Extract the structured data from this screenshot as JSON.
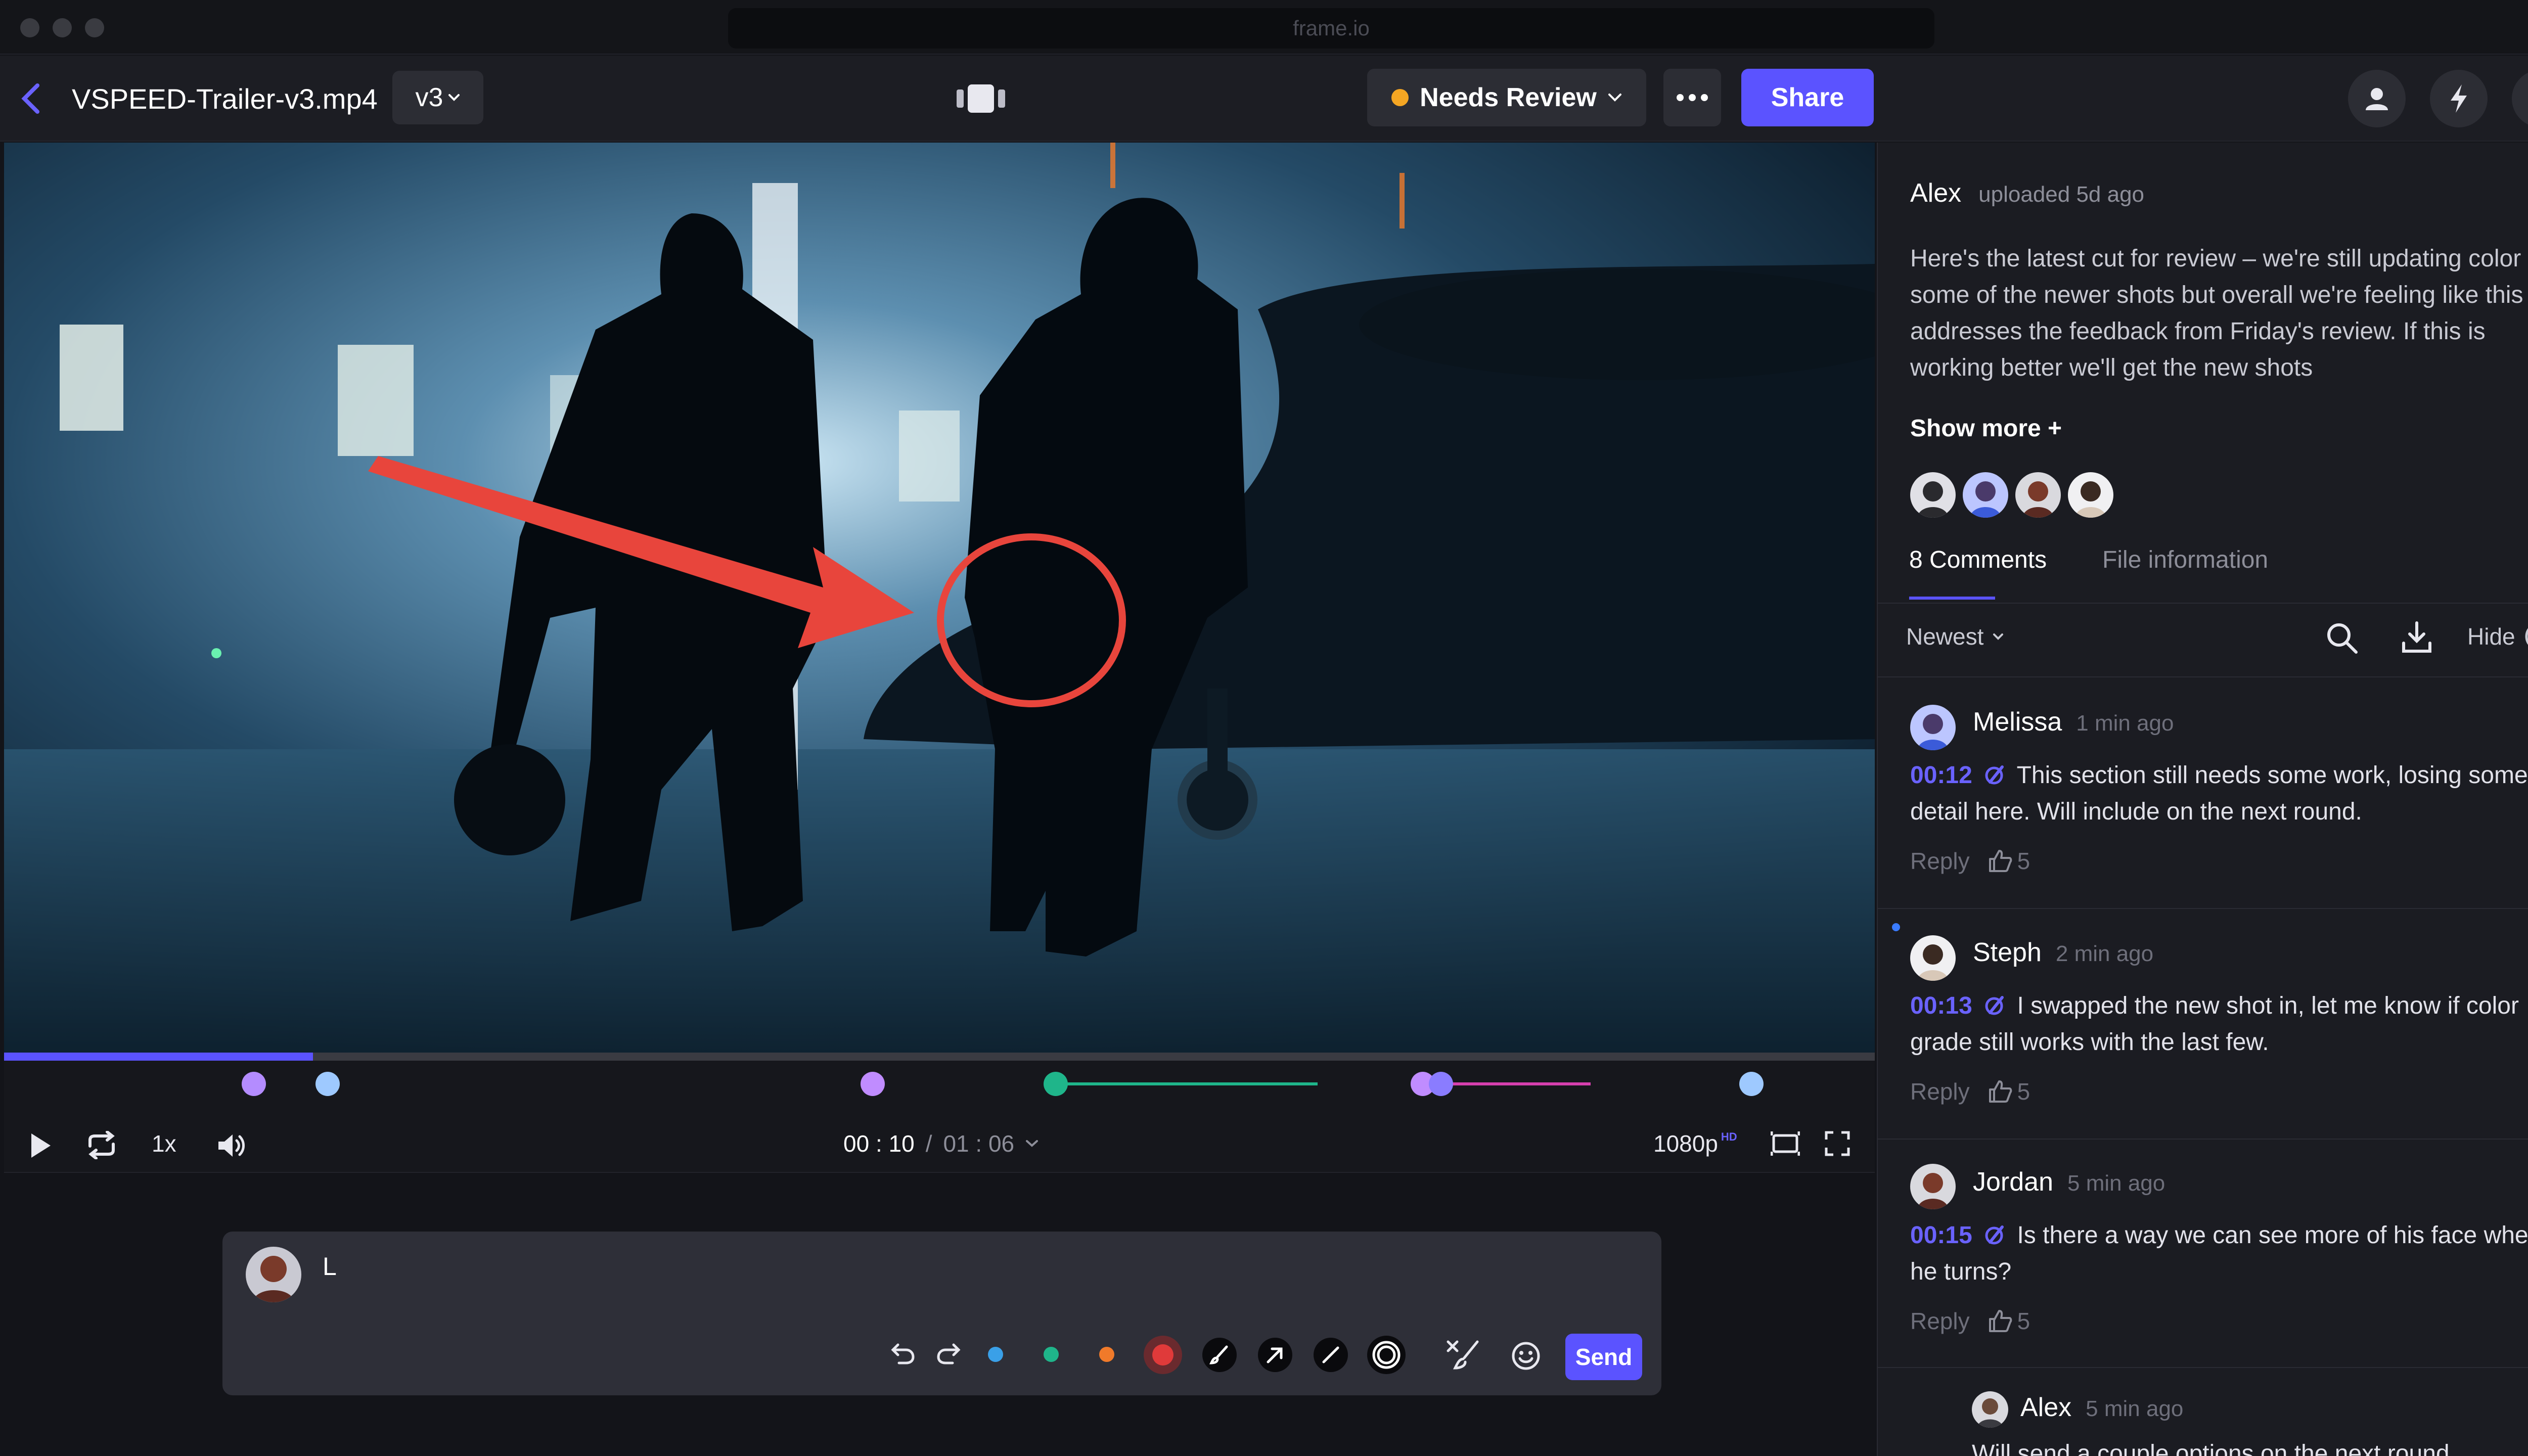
{
  "window": {
    "url": "frame.io"
  },
  "header": {
    "file_name": "VSPEED-Trailer-v3.mp4",
    "version": "v3",
    "status_label": "Needs Review",
    "share_label": "Share",
    "help_label": "?"
  },
  "player": {
    "speed": "1x",
    "current_time": "00 : 10",
    "separator": "/",
    "total_time": "01 : 06",
    "quality": "1080p",
    "quality_badge": "HD",
    "progress_fraction": 0.165
  },
  "composer": {
    "text": "L",
    "send_label": "Send",
    "colors": [
      "#3aa0e8",
      "#1fb58a",
      "#f07a2a",
      "#e03a3a"
    ]
  },
  "sidebar": {
    "uploader": "Alex",
    "uploaded_text": "uploaded 5d ago",
    "description": "Here's the latest cut for review – we're still updating color on some of the newer shots but overall we're feeling like this addresses the feedback from Friday's review. If this is working better we'll get the new shots",
    "show_more": "Show more +",
    "tabs": [
      {
        "label": "8 Comments",
        "active": true
      },
      {
        "label": "File information",
        "active": false
      }
    ],
    "sort_label": "Newest",
    "hide_label": "Hide",
    "comments": [
      {
        "name": "Melissa",
        "time": "1 min ago",
        "timecode": "00:12",
        "text": "This section still needs some work, losing some detail here. Will include on the next round.",
        "reply": "Reply",
        "likes": "5"
      },
      {
        "name": "Steph",
        "time": "2 min ago",
        "timecode": "00:13",
        "text": "I swapped the new shot in, let me know if color grade still works with the last few.",
        "reply": "Reply",
        "likes": "5"
      },
      {
        "name": "Jordan",
        "time": "5 min ago",
        "timecode": "00:15",
        "text": "Is there a way we can see more of his face when he turns?",
        "reply": "Reply",
        "likes": "5"
      }
    ],
    "nested_reply": {
      "name": "Alex",
      "time": "5 min ago",
      "text": "Will send a couple options on the next round"
    }
  },
  "colors": {
    "accent": "#5b53ff",
    "status": "#f5a623",
    "annotation": "#e8453c"
  }
}
